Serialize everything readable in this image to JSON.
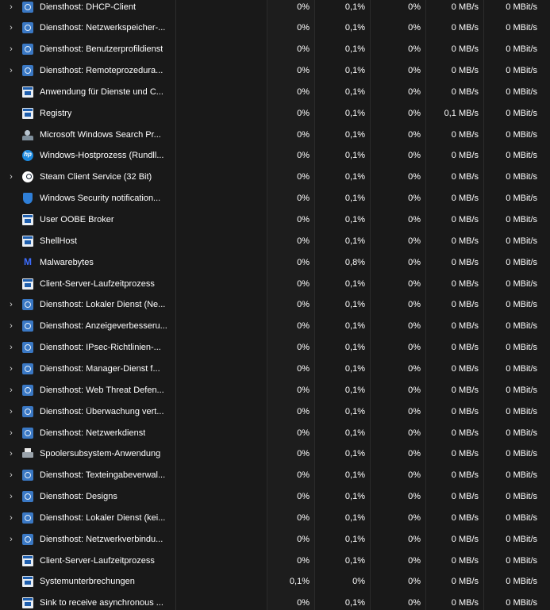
{
  "rows": [
    {
      "expand": true,
      "icon": "gear-icon",
      "name": "Diensthost: DHCP-Client",
      "cpu": "0%",
      "mem": "0,1%",
      "disk": "0%",
      "disk_speed": "0 MB/s",
      "net": "0 MBit/s"
    },
    {
      "expand": true,
      "icon": "gear-icon",
      "name": "Diensthost: Netzwerkspeicher-...",
      "cpu": "0%",
      "mem": "0,1%",
      "disk": "0%",
      "disk_speed": "0 MB/s",
      "net": "0 MBit/s"
    },
    {
      "expand": true,
      "icon": "gear-icon",
      "name": "Diensthost: Benutzerprofildienst",
      "cpu": "0%",
      "mem": "0,1%",
      "disk": "0%",
      "disk_speed": "0 MB/s",
      "net": "0 MBit/s"
    },
    {
      "expand": true,
      "icon": "gear-icon",
      "name": "Diensthost: Remoteprozedura...",
      "cpu": "0%",
      "mem": "0,1%",
      "disk": "0%",
      "disk_speed": "0 MB/s",
      "net": "0 MBit/s"
    },
    {
      "expand": false,
      "icon": "window-icon",
      "name": "Anwendung für Dienste und C...",
      "cpu": "0%",
      "mem": "0,1%",
      "disk": "0%",
      "disk_speed": "0 MB/s",
      "net": "0 MBit/s"
    },
    {
      "expand": false,
      "icon": "window-icon",
      "name": "Registry",
      "cpu": "0%",
      "mem": "0,1%",
      "disk": "0%",
      "disk_speed": "0,1 MB/s",
      "net": "0 MBit/s"
    },
    {
      "expand": false,
      "icon": "search-icon",
      "name": "Microsoft Windows Search Pr...",
      "cpu": "0%",
      "mem": "0,1%",
      "disk": "0%",
      "disk_speed": "0 MB/s",
      "net": "0 MBit/s"
    },
    {
      "expand": false,
      "icon": "hp-icon",
      "name": "Windows-Hostprozess (Rundll...",
      "cpu": "0%",
      "mem": "0,1%",
      "disk": "0%",
      "disk_speed": "0 MB/s",
      "net": "0 MBit/s"
    },
    {
      "expand": true,
      "icon": "steam-icon",
      "name": "Steam Client Service (32 Bit)",
      "cpu": "0%",
      "mem": "0,1%",
      "disk": "0%",
      "disk_speed": "0 MB/s",
      "net": "0 MBit/s"
    },
    {
      "expand": false,
      "icon": "shield-icon",
      "name": "Windows Security notification...",
      "cpu": "0%",
      "mem": "0,1%",
      "disk": "0%",
      "disk_speed": "0 MB/s",
      "net": "0 MBit/s"
    },
    {
      "expand": false,
      "icon": "window-icon",
      "name": "User OOBE Broker",
      "cpu": "0%",
      "mem": "0,1%",
      "disk": "0%",
      "disk_speed": "0 MB/s",
      "net": "0 MBit/s"
    },
    {
      "expand": false,
      "icon": "window-icon",
      "name": "ShellHost",
      "cpu": "0%",
      "mem": "0,1%",
      "disk": "0%",
      "disk_speed": "0 MB/s",
      "net": "0 MBit/s"
    },
    {
      "expand": false,
      "icon": "malwarebytes-icon",
      "name": "Malwarebytes",
      "cpu": "0%",
      "mem": "0,8%",
      "disk": "0%",
      "disk_speed": "0 MB/s",
      "net": "0 MBit/s"
    },
    {
      "expand": false,
      "icon": "window-icon",
      "name": "Client-Server-Laufzeitprozess",
      "cpu": "0%",
      "mem": "0,1%",
      "disk": "0%",
      "disk_speed": "0 MB/s",
      "net": "0 MBit/s"
    },
    {
      "expand": true,
      "icon": "gear-icon",
      "name": "Diensthost: Lokaler Dienst (Ne...",
      "cpu": "0%",
      "mem": "0,1%",
      "disk": "0%",
      "disk_speed": "0 MB/s",
      "net": "0 MBit/s"
    },
    {
      "expand": true,
      "icon": "gear-icon",
      "name": "Diensthost: Anzeigeverbesseru...",
      "cpu": "0%",
      "mem": "0,1%",
      "disk": "0%",
      "disk_speed": "0 MB/s",
      "net": "0 MBit/s"
    },
    {
      "expand": true,
      "icon": "gear-icon",
      "name": "Diensthost: IPsec-Richtlinien-...",
      "cpu": "0%",
      "mem": "0,1%",
      "disk": "0%",
      "disk_speed": "0 MB/s",
      "net": "0 MBit/s"
    },
    {
      "expand": true,
      "icon": "gear-icon",
      "name": "Diensthost: Manager-Dienst f...",
      "cpu": "0%",
      "mem": "0,1%",
      "disk": "0%",
      "disk_speed": "0 MB/s",
      "net": "0 MBit/s"
    },
    {
      "expand": true,
      "icon": "gear-icon",
      "name": "Diensthost: Web Threat Defen...",
      "cpu": "0%",
      "mem": "0,1%",
      "disk": "0%",
      "disk_speed": "0 MB/s",
      "net": "0 MBit/s"
    },
    {
      "expand": true,
      "icon": "gear-icon",
      "name": "Diensthost: Überwachung vert...",
      "cpu": "0%",
      "mem": "0,1%",
      "disk": "0%",
      "disk_speed": "0 MB/s",
      "net": "0 MBit/s"
    },
    {
      "expand": true,
      "icon": "gear-icon",
      "name": "Diensthost: Netzwerkdienst",
      "cpu": "0%",
      "mem": "0,1%",
      "disk": "0%",
      "disk_speed": "0 MB/s",
      "net": "0 MBit/s"
    },
    {
      "expand": true,
      "icon": "printer-icon",
      "name": "Spoolersubsystem-Anwendung",
      "cpu": "0%",
      "mem": "0,1%",
      "disk": "0%",
      "disk_speed": "0 MB/s",
      "net": "0 MBit/s"
    },
    {
      "expand": true,
      "icon": "gear-icon",
      "name": "Diensthost: Texteingabeverwal...",
      "cpu": "0%",
      "mem": "0,1%",
      "disk": "0%",
      "disk_speed": "0 MB/s",
      "net": "0 MBit/s"
    },
    {
      "expand": true,
      "icon": "gear-icon",
      "name": "Diensthost: Designs",
      "cpu": "0%",
      "mem": "0,1%",
      "disk": "0%",
      "disk_speed": "0 MB/s",
      "net": "0 MBit/s"
    },
    {
      "expand": true,
      "icon": "gear-icon",
      "name": "Diensthost: Lokaler Dienst (kei...",
      "cpu": "0%",
      "mem": "0,1%",
      "disk": "0%",
      "disk_speed": "0 MB/s",
      "net": "0 MBit/s"
    },
    {
      "expand": true,
      "icon": "gear-icon",
      "name": "Diensthost: Netzwerkverbindu...",
      "cpu": "0%",
      "mem": "0,1%",
      "disk": "0%",
      "disk_speed": "0 MB/s",
      "net": "0 MBit/s"
    },
    {
      "expand": false,
      "icon": "window-icon",
      "name": "Client-Server-Laufzeitprozess",
      "cpu": "0%",
      "mem": "0,1%",
      "disk": "0%",
      "disk_speed": "0 MB/s",
      "net": "0 MBit/s"
    },
    {
      "expand": false,
      "icon": "window-icon",
      "name": "Systemunterbrechungen",
      "cpu": "0,1%",
      "mem": "0%",
      "disk": "0%",
      "disk_speed": "0 MB/s",
      "net": "0 MBit/s"
    },
    {
      "expand": false,
      "icon": "window-icon",
      "name": "Sink to receive asynchronous ...",
      "cpu": "0%",
      "mem": "0,1%",
      "disk": "0%",
      "disk_speed": "0 MB/s",
      "net": "0 MBit/s"
    }
  ],
  "chevron_glyph": "›",
  "colors": {
    "background": "#191919",
    "row_divider": "#2b2b2b",
    "text": "#ffffff",
    "service_icon": "#3a78c4"
  }
}
